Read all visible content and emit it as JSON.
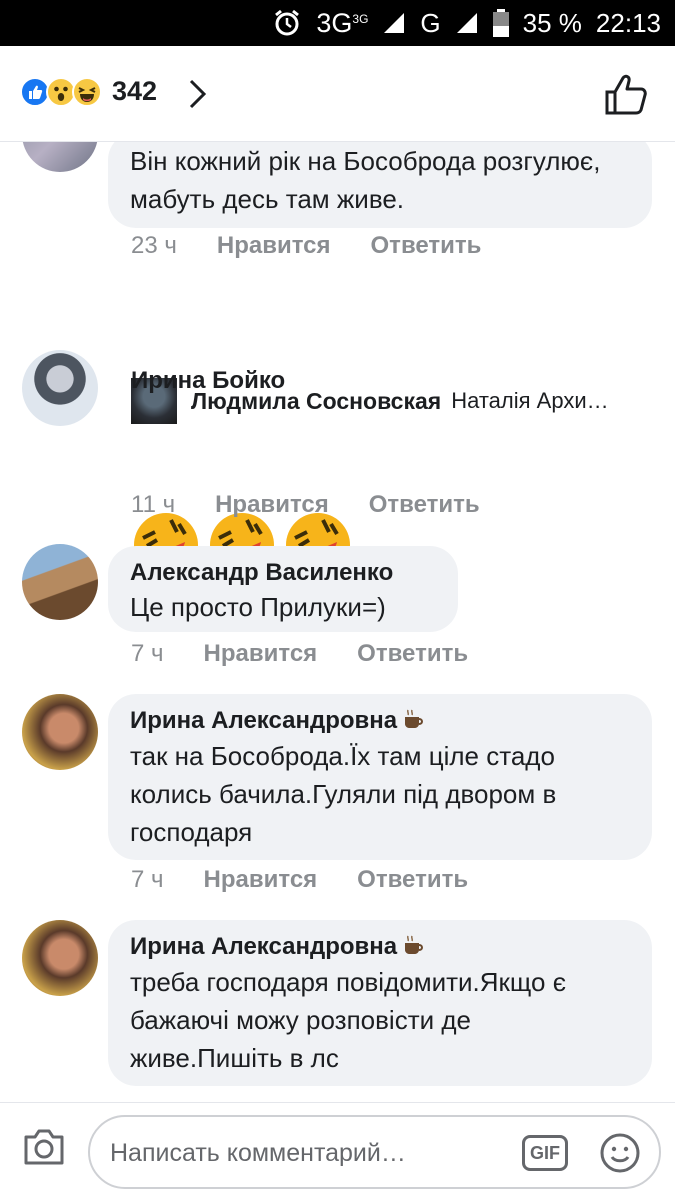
{
  "status_bar": {
    "network": "3G",
    "network_sup": "3G",
    "network2": "G",
    "battery": "35 %",
    "time": "22:13"
  },
  "header": {
    "reaction_count": "342"
  },
  "comments": [
    {
      "text": "Він кожний рік на Бособрода розгулює, мабуть десь там живе.",
      "time": "23 ч",
      "like": "Нравится",
      "reply": "Ответить"
    },
    {
      "author": "Ирина Бойко",
      "time": "11 ч",
      "like": "Нравится",
      "reply": "Ответить"
    },
    {
      "author": "Александр Василенко",
      "text": "Це просто Прилуки=)",
      "time": "7 ч",
      "like": "Нравится",
      "reply": "Ответить"
    },
    {
      "author": "Ирина Александровна",
      "text": "так на Бособрода.Їх там ціле стадо колись бачила.Гуляли під двором в господаря",
      "time": "7 ч",
      "like": "Нравится",
      "reply": "Ответить"
    },
    {
      "author": "Ирина Александровна",
      "text": "треба господаря повідомити.Якщо є бажаючі можу розповісти де живе.Пишіть в лс"
    }
  ],
  "reply_preview": {
    "author": "Людмила Сосновская",
    "snippet": "Наталія Архи…"
  },
  "composer": {
    "placeholder": "Написать комментарий…",
    "gif_label": "GIF"
  },
  "icons": [
    "alarm-icon",
    "signal-icon",
    "battery-icon",
    "like-reaction-icon",
    "wow-reaction-icon",
    "haha-reaction-icon",
    "chevron-right-icon",
    "like-outline-icon",
    "camera-icon",
    "gif-icon",
    "smile-icon",
    "coffee-icon"
  ]
}
